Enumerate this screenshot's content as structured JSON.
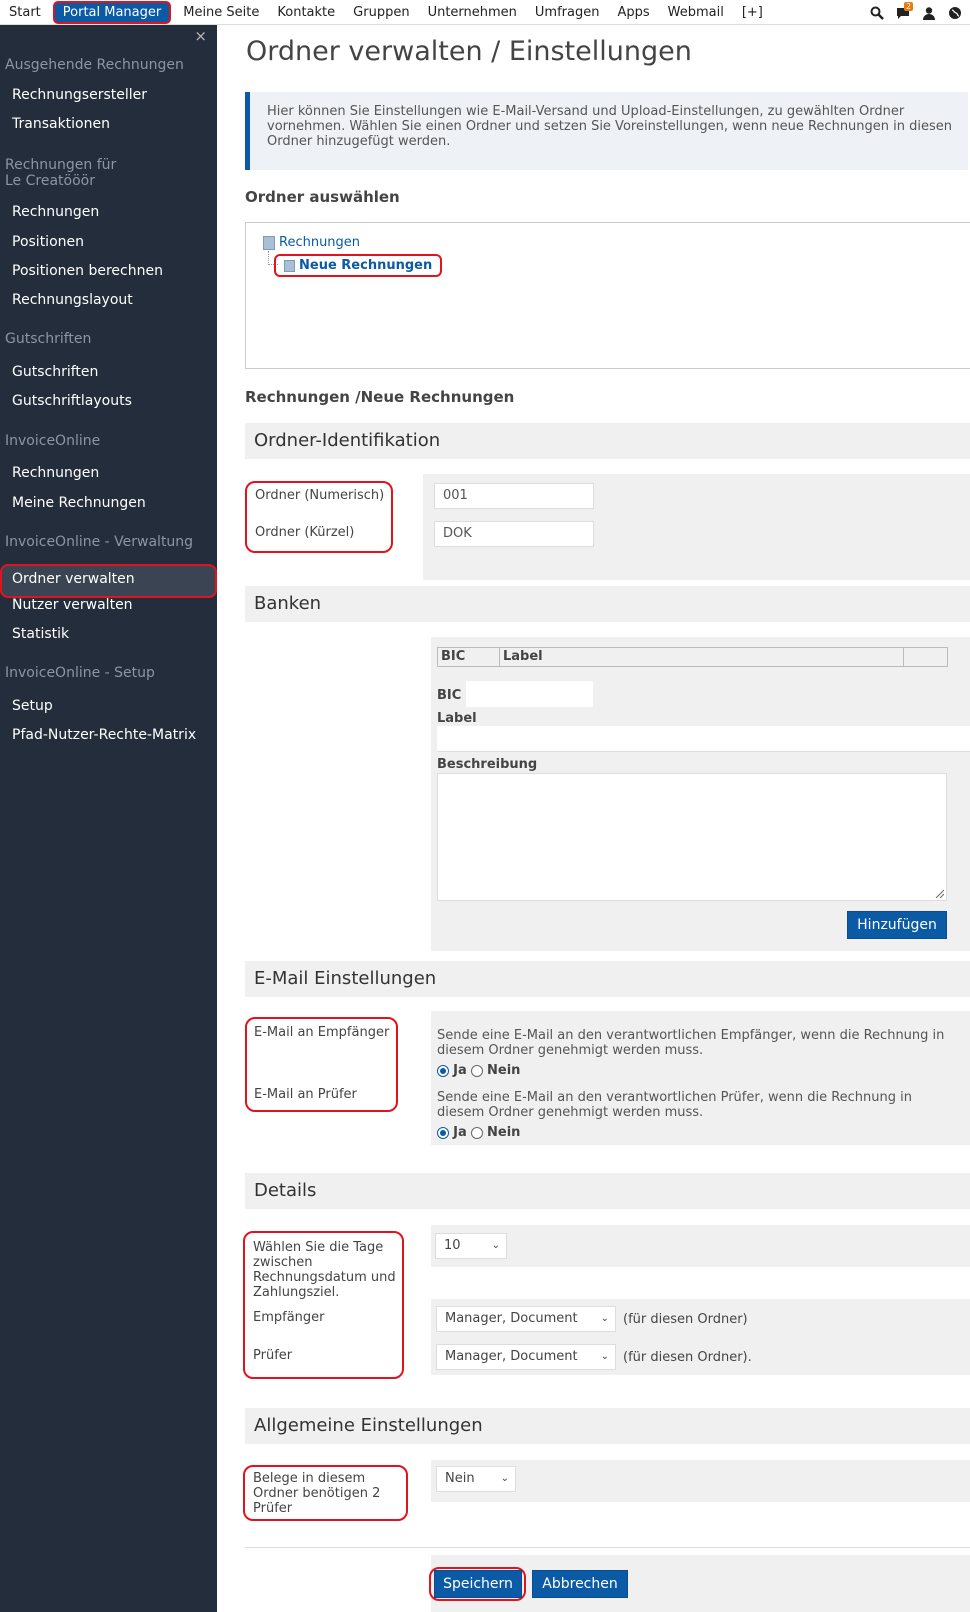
{
  "topbar": {
    "nav": [
      {
        "label": "Start",
        "active": false
      },
      {
        "label": "Portal Manager",
        "active": true
      },
      {
        "label": "Meine Seite",
        "active": false
      },
      {
        "label": "Kontakte",
        "active": false
      },
      {
        "label": "Gruppen",
        "active": false
      },
      {
        "label": "Unternehmen",
        "active": false
      },
      {
        "label": "Umfragen",
        "active": false
      },
      {
        "label": "Apps",
        "active": false
      },
      {
        "label": "Webmail",
        "active": false
      },
      {
        "label": "[+]",
        "active": false
      }
    ],
    "notification_count": "2"
  },
  "sidebar": {
    "close": "×",
    "sections": [
      {
        "title": "Ausgehende Rechnungen",
        "items": [
          "Rechnungsersteller",
          "Transaktionen"
        ]
      },
      {
        "title": "Rechnungen für\nLe Creatööör",
        "items": [
          "Rechnungen",
          "Positionen",
          "Positionen berechnen",
          "Rechnungslayout"
        ]
      },
      {
        "title": "Gutschriften",
        "items": [
          "Gutschriften",
          "Gutschriftlayouts"
        ]
      },
      {
        "title": "InvoiceOnline",
        "items": [
          "Rechnungen",
          "Meine Rechnungen"
        ]
      },
      {
        "title": "InvoiceOnline - Verwaltung",
        "items": [
          "Ordner verwalten",
          "Nutzer verwalten",
          "Statistik"
        ]
      },
      {
        "title": "InvoiceOnline - Setup",
        "items": [
          "Setup",
          "Pfad-Nutzer-Rechte-Matrix"
        ]
      }
    ],
    "active_item": "Ordner verwalten"
  },
  "main": {
    "title": "Ordner verwalten / Einstellungen",
    "info": "Hier können Sie Einstellungen wie E-Mail-Versand und Upload-Einstellungen, zu gewählten Ordner vornehmen. Wählen Sie einen Ordner und setzen Sie Voreinstellungen, wenn neue Rechnungen in diesen Ordner hinzugefügt werden.",
    "select_folder_label": "Ordner auswählen",
    "tree": {
      "root": "Rechnungen",
      "child": "Neue Rechnungen"
    },
    "path": "Rechnungen /Neue Rechnungen",
    "identification": {
      "heading": "Ordner-Identifikation",
      "numeric_label": "Ordner (Numerisch)",
      "numeric_value": "001",
      "short_label": "Ordner (Kürzel)",
      "short_value": "DOK"
    },
    "banks": {
      "heading": "Banken",
      "col_bic": "BIC",
      "col_label": "Label",
      "bic_label": "BIC",
      "label_label": "Label",
      "desc_label": "Beschreibung",
      "add_button": "Hinzufügen"
    },
    "email": {
      "heading": "E-Mail Einstellungen",
      "recipient_label": "E-Mail an Empfänger",
      "recipient_desc": "Sende eine E-Mail an den verantwortlichen Empfänger, wenn die Rechnung in diesem Ordner genehmigt werden muss.",
      "checker_label": "E-Mail an Prüfer",
      "checker_desc": "Sende eine E-Mail an den verantwortlichen Prüfer, wenn die Rechnung in diesem Ordner genehmigt werden muss.",
      "yes": "Ja",
      "no": "Nein"
    },
    "details": {
      "heading": "Details",
      "days_label": "Wählen Sie die Tage zwischen Rechnungsdatum und Zahlungsziel.",
      "days_value": "10",
      "recipient_label": "Empfänger",
      "recipient_value": "Manager, Document",
      "recipient_suffix": "(für diesen Ordner)",
      "checker_label": "Prüfer",
      "checker_value": "Manager, Document",
      "checker_suffix": "(für diesen Ordner)."
    },
    "general": {
      "heading": "Allgemeine Einstellungen",
      "two_checkers_label": "Belege in diesem Ordner benötigen 2 Prüfer",
      "two_checkers_value": "Nein"
    },
    "save_button": "Speichern",
    "cancel_button": "Abbrechen"
  }
}
